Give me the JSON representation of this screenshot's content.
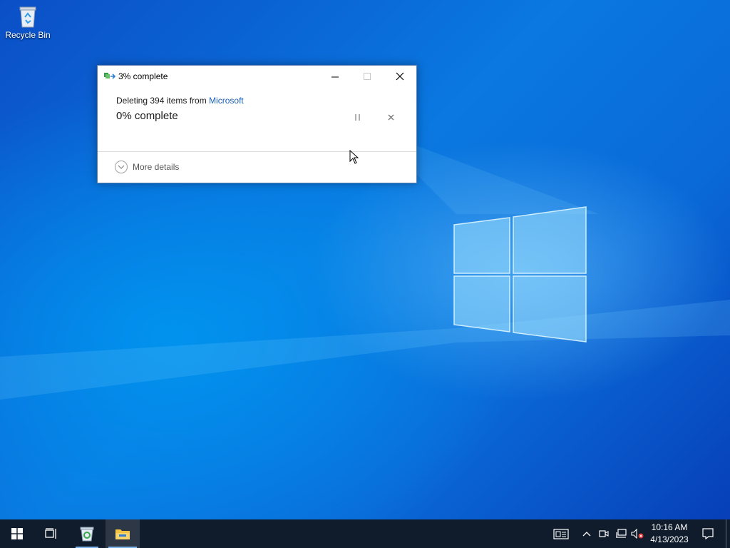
{
  "desktop": {
    "icons": [
      {
        "label": "Recycle Bin",
        "icon": "recycle-bin-icon"
      }
    ]
  },
  "dialog": {
    "title": "3% complete",
    "operation_prefix": "Deleting 394 items from ",
    "source_link": "Microsoft",
    "progress_text": "0% complete",
    "progress_percent": 0,
    "more_details_label": "More details",
    "buttons": {
      "minimize": "minimize-icon",
      "maximize": "maximize-icon",
      "close": "close-icon",
      "pause": "pause-icon",
      "cancel": "cancel-icon"
    }
  },
  "taskbar": {
    "apps": [
      "start-icon",
      "task-view-icon",
      "recycle-bin-app-icon",
      "file-explorer-icon"
    ],
    "tray": [
      "news-icon",
      "chevron-up-icon",
      "meet-now-icon",
      "network-icon",
      "volume-muted-icon"
    ],
    "clock": {
      "time": "10:16 AM",
      "date": "4/13/2023"
    },
    "notification": "notification-icon"
  },
  "colors": {
    "accent": "#1a5fb4",
    "taskbar": "#101c2c",
    "desktop": "#0a6ad8"
  }
}
